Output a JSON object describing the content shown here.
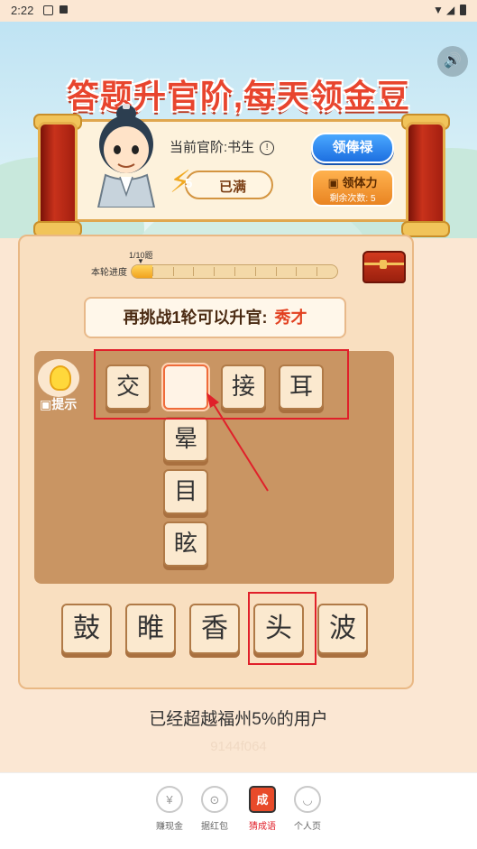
{
  "status_bar": {
    "time": "2:22"
  },
  "header": {
    "title": "答题升官阶,每天领金豆",
    "rank_label": "当前官阶:书生",
    "salary_button": "领俸禄",
    "energy_count": "5",
    "energy_status": "已满",
    "stamina_button": "领体力",
    "stamina_remaining": "剩余次数: 5"
  },
  "progress": {
    "count": "1/10题",
    "label": "本轮进度",
    "fraction": 0.1
  },
  "challenge": {
    "text": "再挑战1轮可以升官:",
    "next_rank": "秀才"
  },
  "hint": {
    "label": "提示"
  },
  "puzzle": {
    "row": [
      "交",
      "",
      "接",
      "耳"
    ],
    "column": [
      "晕",
      "目",
      "眩"
    ]
  },
  "choices": [
    "鼓",
    "睢",
    "香",
    "头",
    "波"
  ],
  "footer": {
    "rank_note": "已经超越福州5%的用户",
    "watermark": "9144f064"
  },
  "nav": [
    {
      "label": "赚现金",
      "icon": "¥"
    },
    {
      "label": "据红包",
      "icon": "⊙"
    },
    {
      "label": "猜成语",
      "icon": "成"
    },
    {
      "label": "个人页",
      "icon": "◡"
    }
  ],
  "colors": {
    "accent": "#e0202a",
    "title": "#e8452e",
    "board": "#c99563"
  }
}
